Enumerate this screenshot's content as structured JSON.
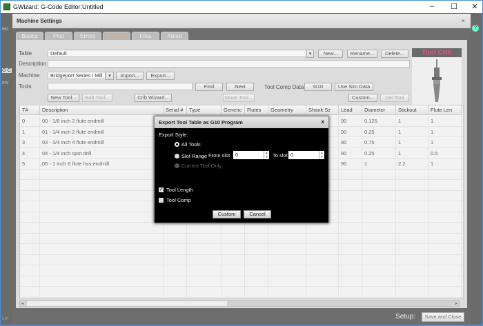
{
  "window": {
    "title": "GWizard: G-Code Editor:Untitled",
    "minimize": "–",
    "maximize": "☐",
    "close": "✕"
  },
  "sidebar": {
    "items": [
      "Ho",
      "Inv",
      "G-C",
      "Lin"
    ]
  },
  "dialog": {
    "title": "Machine Settings",
    "close": "×",
    "help": "?",
    "tabs": [
      {
        "label": "Basics"
      },
      {
        "label": "Post"
      },
      {
        "label": "Errors"
      },
      {
        "label": "Tool Crib",
        "active": true
      },
      {
        "label": "Files"
      },
      {
        "label": "About"
      }
    ],
    "table_label": "Table",
    "table_value": "Default",
    "new_btn": "New...",
    "rename_btn": "Rename...",
    "delete_btn": "Delete...",
    "description_label": "Description",
    "description_value": "",
    "machine_label": "Machine",
    "machine_value": "Bridgeport Series I Mill",
    "import_btn": "Import...",
    "export_btn": "Export...",
    "tools_label": "Tools",
    "tools_value": "",
    "find_btn": "Find",
    "next_btn": "Next",
    "tool_comp_label": "Tool Comp Data",
    "g10_btn": "G10",
    "use_sim_btn": "Use Sim Data",
    "new_tool_btn": "New Tool...",
    "edit_tool_btn": "Edit Tool...",
    "crib_wizard_btn": "Crib Wizard...",
    "move_tool_btn": "Move Tool...",
    "custom_btn": "Custom...",
    "del_tool_btn": "Del Tool",
    "crib_title": "Tool Crib",
    "columns": [
      "T#",
      "Description",
      "Serial #",
      "Type",
      "Generic",
      "Flutes",
      "Geometry",
      "Shank Sz",
      "Lead",
      "Diameter",
      "Stickout",
      "Flute Len"
    ],
    "rows": [
      [
        "0",
        "00 - 1/8 inch 2 flute endmill",
        "",
        "",
        "",
        "",
        "",
        "",
        "90",
        "0.125",
        "1",
        "1"
      ],
      [
        "1",
        "01 - 1/4 inch 2 flute endmill",
        "",
        "",
        "",
        "",
        "",
        "",
        "90",
        "0.25",
        "1",
        "1"
      ],
      [
        "3",
        "03 - 3/4 inch 4 flute endmill",
        "",
        "",
        "",
        "",
        "",
        "",
        "90",
        "0.75",
        "1",
        "1"
      ],
      [
        "4",
        "04 - 1/4 inch spot drill",
        "",
        "",
        "",
        "",
        "",
        "",
        "90",
        "0.25",
        "1",
        "0.5"
      ],
      [
        "5",
        "05 - 1 inch 6 flute hss endmill",
        "",
        "",
        "",
        "",
        "",
        "",
        "90",
        "1",
        "2.2",
        "1"
      ]
    ],
    "setup_label": "Setup:",
    "save_close_btn": "Save and Close"
  },
  "modal": {
    "title": "Export Tool Table as G10 Program",
    "close": "x",
    "export_style": "Export Style:",
    "all_tools": "All Tools",
    "slot_range": "Slot Range",
    "from_slot": "From slot",
    "from_value": "0",
    "to_slot": "To slot",
    "to_value": "0",
    "current_tool": "Current Tool Only",
    "tool_length": "Tool Length",
    "tool_length_checked": true,
    "tool_comp": "Tool Comp",
    "tool_comp_checked": false,
    "custom_btn": "Custom",
    "cancel_btn": "Cancel"
  }
}
